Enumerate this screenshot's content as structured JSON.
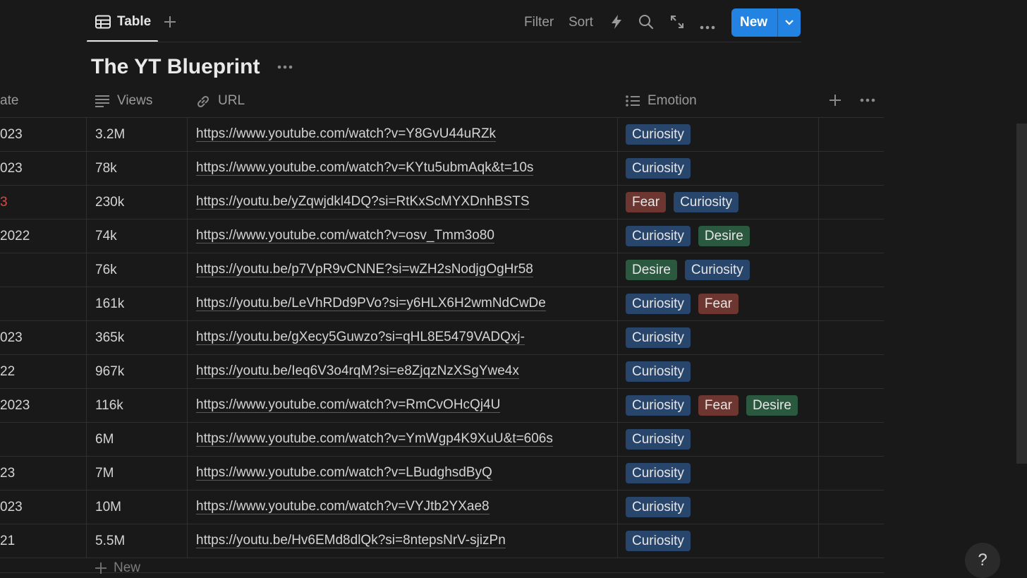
{
  "toolbar": {
    "view_tab_label": "Table",
    "filter_label": "Filter",
    "sort_label": "Sort",
    "new_label": "New"
  },
  "database": {
    "title": "The YT Blueprint"
  },
  "columns": {
    "date_partial": "ate",
    "views": "Views",
    "url": "URL",
    "emotion": "Emotion"
  },
  "rows": [
    {
      "date": "023",
      "date_color": "#d4d4d4",
      "views": "3.2M",
      "url": "https://www.youtube.com/watch?v=Y8GvU44uRZk",
      "emotions": [
        "Curiosity"
      ]
    },
    {
      "date": "023",
      "date_color": "#d4d4d4",
      "views": "78k",
      "url": "https://www.youtube.com/watch?v=KYtu5ubmAqk&t=10s",
      "emotions": [
        "Curiosity"
      ]
    },
    {
      "date": "3",
      "date_color": "#d44c47",
      "views": "230k",
      "url": "https://youtu.be/yZqwjdkl4DQ?si=RtKxScMYXDnhBSTS",
      "emotions": [
        "Fear",
        "Curiosity"
      ]
    },
    {
      "date": "2022",
      "date_color": "#d4d4d4",
      "views": "74k",
      "url": "https://www.youtube.com/watch?v=osv_Tmm3o80",
      "emotions": [
        "Curiosity",
        "Desire"
      ]
    },
    {
      "date": "",
      "date_color": "#d4d4d4",
      "views": "76k",
      "url": "https://youtu.be/p7VpR9vCNNE?si=wZH2sNodjgOgHr58",
      "emotions": [
        "Desire",
        "Curiosity"
      ]
    },
    {
      "date": "",
      "date_color": "#d4d4d4",
      "views": "161k",
      "url": "https://youtu.be/LeVhRDd9PVo?si=y6HLX6H2wmNdCwDe",
      "emotions": [
        "Curiosity",
        "Fear"
      ]
    },
    {
      "date": "023",
      "date_color": "#d4d4d4",
      "views": "365k",
      "url": "https://youtu.be/gXecy5Guwzo?si=qHL8E5479VADQxj-",
      "emotions": [
        "Curiosity"
      ]
    },
    {
      "date": "22",
      "date_color": "#d4d4d4",
      "views": "967k",
      "url": "https://youtu.be/Ieq6V3o4rqM?si=e8ZjqzNzXSgYwe4x",
      "emotions": [
        "Curiosity"
      ]
    },
    {
      "date": "2023",
      "date_color": "#d4d4d4",
      "views": "116k",
      "url": "https://www.youtube.com/watch?v=RmCvOHcQj4U",
      "emotions": [
        "Curiosity",
        "Fear",
        "Desire"
      ]
    },
    {
      "date": "",
      "date_color": "#d4d4d4",
      "views": "6M",
      "url": "https://www.youtube.com/watch?v=YmWgp4K9XuU&t=606s",
      "emotions": [
        "Curiosity"
      ]
    },
    {
      "date": "23",
      "date_color": "#d4d4d4",
      "views": "7M",
      "url": "https://www.youtube.com/watch?v=LBudghsdByQ",
      "emotions": [
        "Curiosity"
      ]
    },
    {
      "date": "023",
      "date_color": "#d4d4d4",
      "views": "10M",
      "url": "https://www.youtube.com/watch?v=VYJtb2YXae8",
      "emotions": [
        "Curiosity"
      ]
    },
    {
      "date": "21",
      "date_color": "#d4d4d4",
      "views": "5.5M",
      "url": "https://youtu.be/Hv6EMd8dlQk?si=8ntepsNrV-sjizPn",
      "emotions": [
        "Curiosity"
      ]
    }
  ],
  "footer": {
    "new_row_label": "New",
    "help_label": "?"
  },
  "colors": {
    "accent": "#2383e2",
    "tag_curiosity": "#28456c",
    "tag_fear": "#6e3630",
    "tag_desire": "#2b593f"
  },
  "icons": {
    "view_tab": "table-grid-icon",
    "views_column": "text-lines-icon",
    "url_column": "link-icon",
    "emotion_column": "list-icon"
  }
}
